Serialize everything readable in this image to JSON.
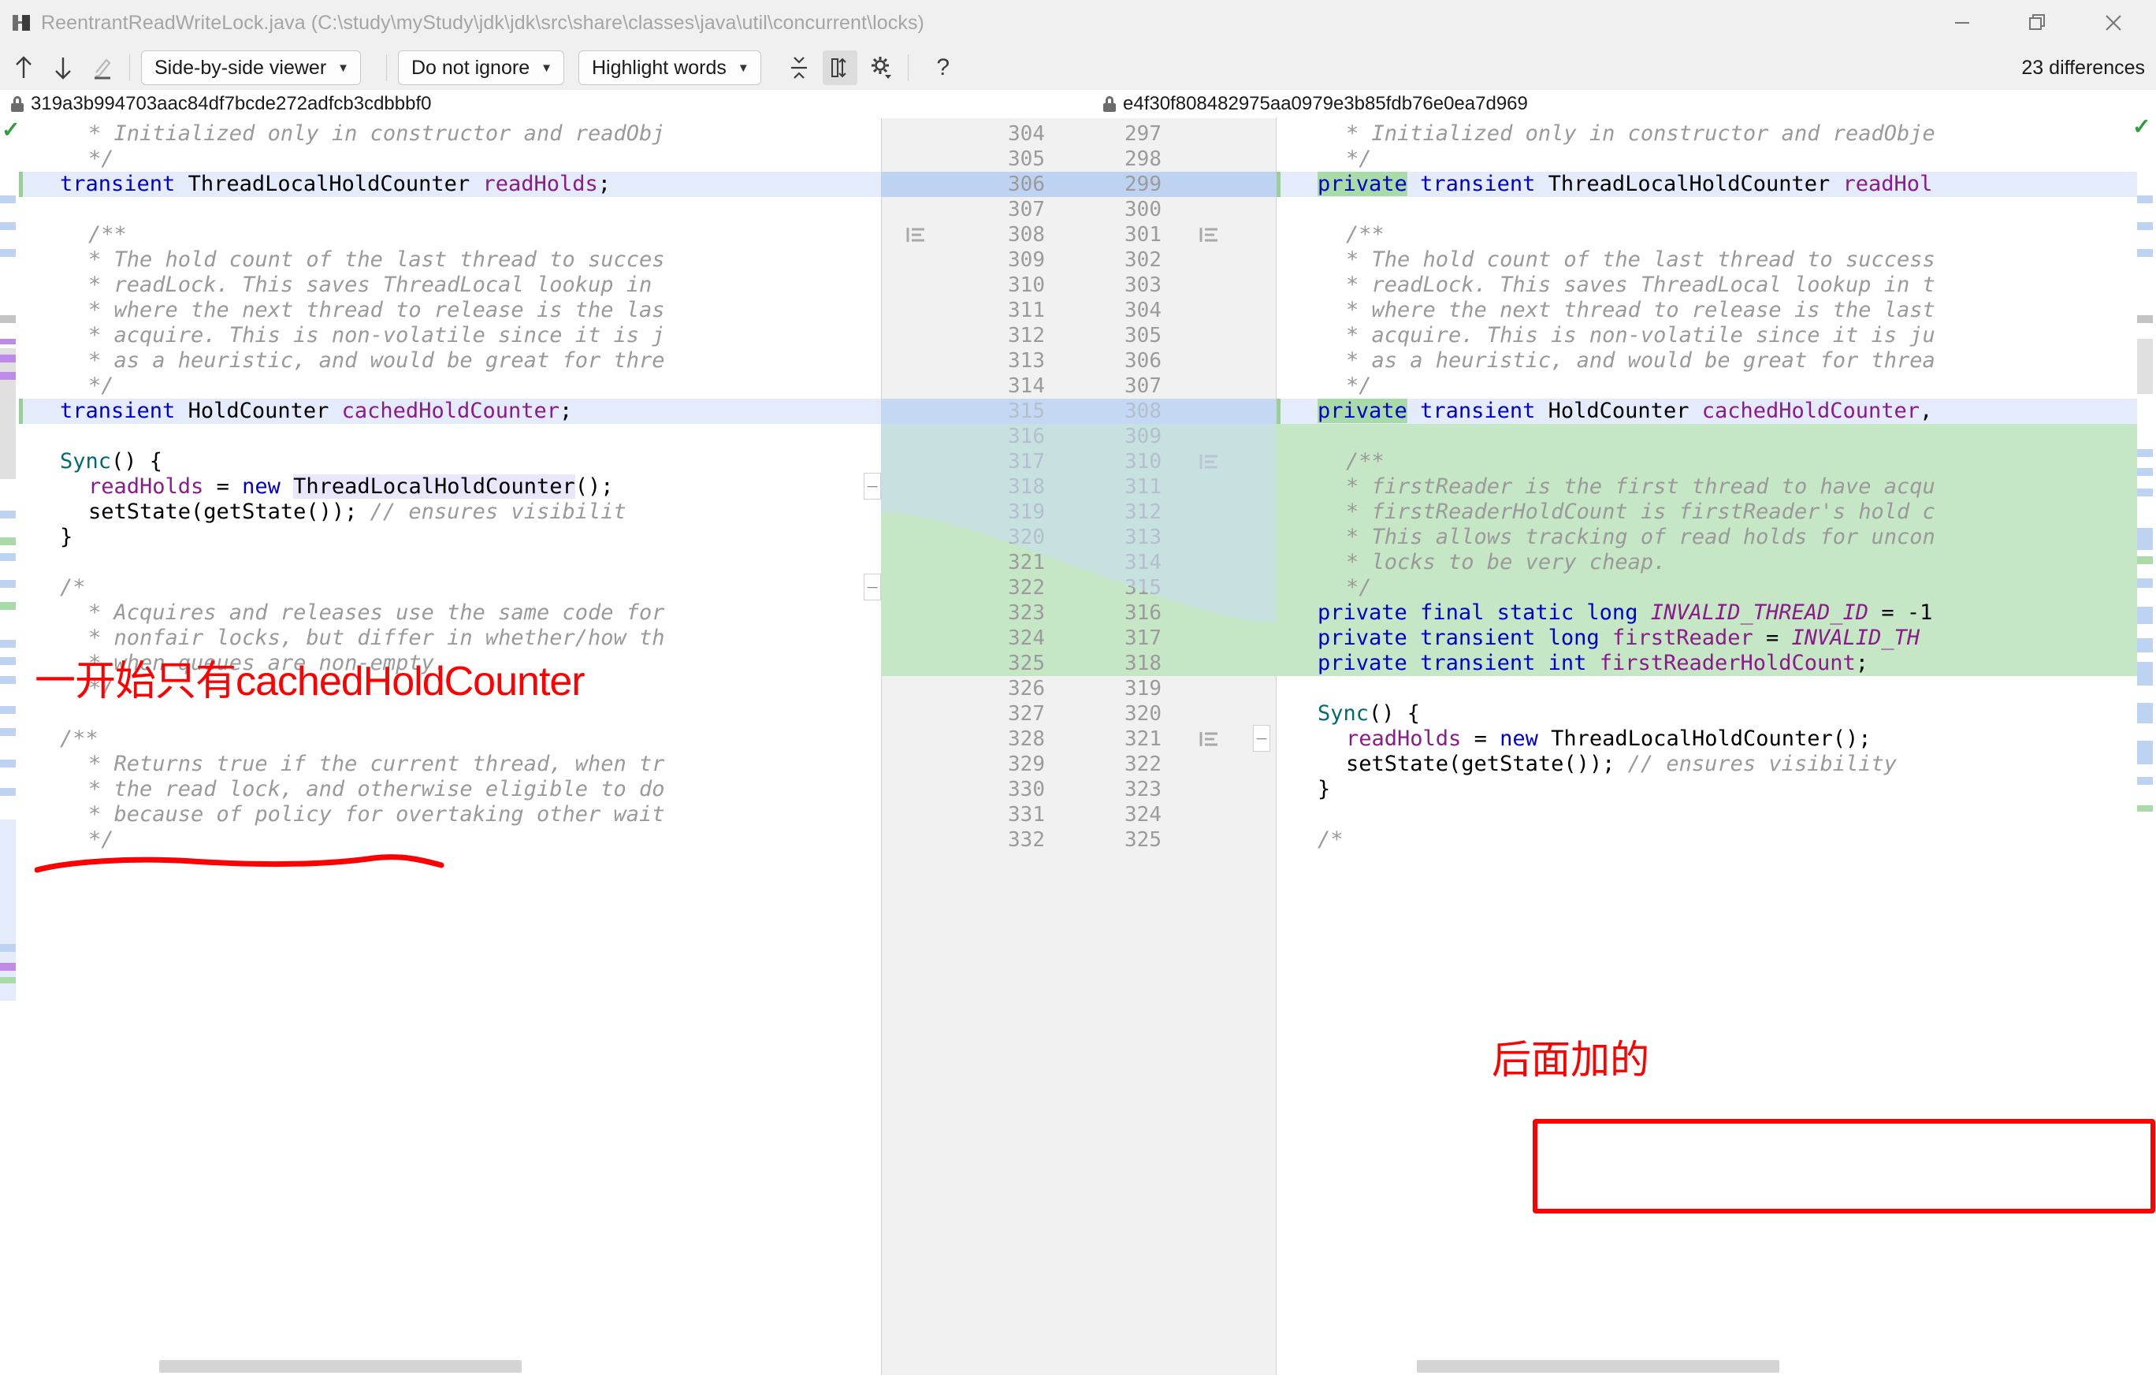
{
  "window": {
    "title": "ReentrantReadWriteLock.java (C:\\study\\myStudy\\jdk\\jdk\\src\\share\\classes\\java\\util\\concurrent\\locks)",
    "app_icon": "diff-icon",
    "minimize_label": "—",
    "maximize_label": "❐",
    "close_label": "✕"
  },
  "toolbar": {
    "prev_diff_icon": "arrow-up-icon",
    "next_diff_icon": "arrow-down-icon",
    "edit_icon": "pencil-icon",
    "viewer_mode": "Side-by-side viewer",
    "ignore_mode": "Do not ignore",
    "highlight_mode": "Highlight words",
    "caret": "▼",
    "collapse_icon": "collapse-unchanged-icon",
    "align_icon": "align-columns-icon",
    "settings_icon": "gear-icon",
    "help_icon": "help-icon",
    "differences_label": "23 differences"
  },
  "revisions": {
    "left_hash": "319a3b994703aac84df7bcde272adfcb3cdbbbf0",
    "right_hash": "e4f30f808482975aa0979e3b85fdb76e0ea7d969",
    "lock_icon": "lock-icon"
  },
  "annotations": [
    {
      "id": "note-before",
      "text": "一开始只有cachedHoldCounter",
      "color": "#ff0000"
    },
    {
      "id": "note-after",
      "text": "后面加的",
      "color": "#ff0000"
    }
  ],
  "left_pane": {
    "line_numbers": [
      304,
      305,
      306,
      307,
      308,
      309,
      310,
      311,
      312,
      313,
      314,
      315,
      316,
      317,
      318,
      319,
      320,
      321,
      322,
      323,
      324,
      325,
      326,
      327,
      328,
      329,
      330,
      331,
      332
    ],
    "lines": [
      {
        "n": 304,
        "state": "same",
        "indent": 1,
        "tokens": [
          {
            "t": "* Initialized only in constructor and readObj",
            "c": "c"
          }
        ]
      },
      {
        "n": 305,
        "state": "same",
        "indent": 1,
        "tokens": [
          {
            "t": "*/",
            "c": "c"
          }
        ]
      },
      {
        "n": 306,
        "state": "changed",
        "indent": 0,
        "tokens": [
          {
            "t": "transient",
            "c": "k"
          },
          {
            "t": " ",
            "c": "t"
          },
          {
            "t": "ThreadLocalHoldCounter",
            "c": "t"
          },
          {
            "t": " ",
            "c": "t"
          },
          {
            "t": "readHolds",
            "c": "f"
          },
          {
            "t": ";",
            "c": "t"
          }
        ]
      },
      {
        "n": 307,
        "state": "same",
        "indent": 0,
        "tokens": []
      },
      {
        "n": 308,
        "state": "same",
        "indent": 1,
        "tokens": [
          {
            "t": "/**",
            "c": "c"
          }
        ]
      },
      {
        "n": 309,
        "state": "same",
        "indent": 1,
        "tokens": [
          {
            "t": "* The hold count of the last thread to succes",
            "c": "c"
          }
        ]
      },
      {
        "n": 310,
        "state": "same",
        "indent": 1,
        "tokens": [
          {
            "t": "* readLock. This saves ThreadLocal lookup in",
            "c": "c"
          }
        ]
      },
      {
        "n": 311,
        "state": "same",
        "indent": 1,
        "tokens": [
          {
            "t": "* where the next thread to release is the las",
            "c": "c"
          }
        ]
      },
      {
        "n": 312,
        "state": "same",
        "indent": 1,
        "tokens": [
          {
            "t": "* acquire. This is non-volatile since it is j",
            "c": "c"
          }
        ]
      },
      {
        "n": 313,
        "state": "same",
        "indent": 1,
        "tokens": [
          {
            "t": "* as a heuristic, and would be great for thre",
            "c": "c"
          }
        ]
      },
      {
        "n": 314,
        "state": "same",
        "indent": 1,
        "tokens": [
          {
            "t": "*/",
            "c": "c"
          }
        ]
      },
      {
        "n": 315,
        "state": "changed",
        "indent": 0,
        "tokens": [
          {
            "t": "transient",
            "c": "k"
          },
          {
            "t": " ",
            "c": "t"
          },
          {
            "t": "HoldCounter",
            "c": "t"
          },
          {
            "t": " ",
            "c": "t"
          },
          {
            "t": "cachedHoldCounter",
            "c": "f"
          },
          {
            "t": ";",
            "c": "t"
          }
        ]
      },
      {
        "n": 316,
        "state": "same",
        "indent": 0,
        "tokens": []
      },
      {
        "n": 317,
        "state": "same",
        "indent": 0,
        "tokens": [
          {
            "t": "Sync",
            "c": "m"
          },
          {
            "t": "() {",
            "c": "t"
          }
        ]
      },
      {
        "n": 318,
        "state": "same",
        "indent": 1,
        "tokens": [
          {
            "t": "readHolds",
            "c": "f"
          },
          {
            "t": " = ",
            "c": "t"
          },
          {
            "t": "new",
            "c": "k"
          },
          {
            "t": " ",
            "c": "t"
          },
          {
            "t": "ThreadLocalHoldCounter",
            "c": "t",
            "hl": "lav"
          },
          {
            "t": "();",
            "c": "t"
          }
        ]
      },
      {
        "n": 319,
        "state": "same",
        "indent": 1,
        "tokens": [
          {
            "t": "setState(getState()); ",
            "c": "t"
          },
          {
            "t": "// ensures visibilit",
            "c": "c"
          }
        ]
      },
      {
        "n": 320,
        "state": "same",
        "indent": 0,
        "tokens": [
          {
            "t": "}",
            "c": "t"
          }
        ]
      },
      {
        "n": 321,
        "state": "same",
        "indent": 0,
        "tokens": []
      },
      {
        "n": 322,
        "state": "same",
        "indent": 0,
        "tokens": [
          {
            "t": "/*",
            "c": "c"
          }
        ]
      },
      {
        "n": 323,
        "state": "same",
        "indent": 1,
        "tokens": [
          {
            "t": "* Acquires and releases use the same code for",
            "c": "c"
          }
        ]
      },
      {
        "n": 324,
        "state": "same",
        "indent": 1,
        "tokens": [
          {
            "t": "* nonfair locks, but differ in whether/how th",
            "c": "c"
          }
        ]
      },
      {
        "n": 325,
        "state": "same",
        "indent": 1,
        "tokens": [
          {
            "t": "* when queues are non-empty.",
            "c": "c"
          }
        ]
      },
      {
        "n": 326,
        "state": "same",
        "indent": 1,
        "tokens": [
          {
            "t": "*/",
            "c": "c"
          }
        ]
      },
      {
        "n": 327,
        "state": "same",
        "indent": 0,
        "tokens": []
      },
      {
        "n": 328,
        "state": "same",
        "indent": 0,
        "tokens": [
          {
            "t": "/**",
            "c": "c"
          }
        ]
      },
      {
        "n": 329,
        "state": "same",
        "indent": 1,
        "tokens": [
          {
            "t": "* Returns true if the current thread, when tr",
            "c": "c"
          }
        ]
      },
      {
        "n": 330,
        "state": "same",
        "indent": 1,
        "tokens": [
          {
            "t": "* the read lock, and otherwise eligible to do",
            "c": "c"
          }
        ]
      },
      {
        "n": 331,
        "state": "same",
        "indent": 1,
        "tokens": [
          {
            "t": "* because of policy for overtaking other wait",
            "c": "c"
          }
        ]
      },
      {
        "n": 332,
        "state": "same",
        "indent": 1,
        "tokens": [
          {
            "t": "*/",
            "c": "c"
          }
        ]
      }
    ]
  },
  "right_pane": {
    "line_numbers": [
      297,
      298,
      299,
      300,
      301,
      302,
      303,
      304,
      305,
      306,
      307,
      308,
      309,
      310,
      311,
      312,
      313,
      314,
      315,
      316,
      317,
      318,
      319,
      320,
      321,
      322,
      323,
      324,
      325
    ],
    "lines": [
      {
        "n": 297,
        "state": "same",
        "indent": 1,
        "tokens": [
          {
            "t": "* Initialized only in constructor and readObje",
            "c": "c"
          }
        ]
      },
      {
        "n": 298,
        "state": "same",
        "indent": 1,
        "tokens": [
          {
            "t": "*/",
            "c": "c"
          }
        ]
      },
      {
        "n": 299,
        "state": "changed",
        "indent": 0,
        "tokens": [
          {
            "t": "private",
            "c": "k",
            "hl": "green"
          },
          {
            "t": " ",
            "c": "t"
          },
          {
            "t": "transient",
            "c": "k"
          },
          {
            "t": " ",
            "c": "t"
          },
          {
            "t": "ThreadLocalHoldCounter",
            "c": "t"
          },
          {
            "t": " ",
            "c": "t"
          },
          {
            "t": "readHol",
            "c": "f"
          }
        ]
      },
      {
        "n": 300,
        "state": "same",
        "indent": 0,
        "tokens": []
      },
      {
        "n": 301,
        "state": "same",
        "indent": 1,
        "tokens": [
          {
            "t": "/**",
            "c": "c"
          }
        ]
      },
      {
        "n": 302,
        "state": "same",
        "indent": 1,
        "tokens": [
          {
            "t": "* The hold count of the last thread to success",
            "c": "c"
          }
        ]
      },
      {
        "n": 303,
        "state": "same",
        "indent": 1,
        "tokens": [
          {
            "t": "* readLock. This saves ThreadLocal lookup in t",
            "c": "c"
          }
        ]
      },
      {
        "n": 304,
        "state": "same",
        "indent": 1,
        "tokens": [
          {
            "t": "* where the next thread to release is the last",
            "c": "c"
          }
        ]
      },
      {
        "n": 305,
        "state": "same",
        "indent": 1,
        "tokens": [
          {
            "t": "* acquire. This is non-volatile since it is ju",
            "c": "c"
          }
        ]
      },
      {
        "n": 306,
        "state": "same",
        "indent": 1,
        "tokens": [
          {
            "t": "* as a heuristic, and would be great for threa",
            "c": "c"
          }
        ]
      },
      {
        "n": 307,
        "state": "same",
        "indent": 1,
        "tokens": [
          {
            "t": "*/",
            "c": "c"
          }
        ]
      },
      {
        "n": 308,
        "state": "changed",
        "indent": 0,
        "tokens": [
          {
            "t": "private",
            "c": "k",
            "hl": "green"
          },
          {
            "t": " ",
            "c": "t"
          },
          {
            "t": "transient",
            "c": "k"
          },
          {
            "t": " ",
            "c": "t"
          },
          {
            "t": "HoldCounter",
            "c": "t"
          },
          {
            "t": " ",
            "c": "t"
          },
          {
            "t": "cachedHoldCounter",
            "c": "f"
          },
          {
            "t": ",",
            "c": "t"
          }
        ]
      },
      {
        "n": 309,
        "state": "added",
        "indent": 0,
        "tokens": []
      },
      {
        "n": 310,
        "state": "added",
        "indent": 1,
        "tokens": [
          {
            "t": "/**",
            "c": "c"
          }
        ]
      },
      {
        "n": 311,
        "state": "added",
        "indent": 1,
        "tokens": [
          {
            "t": "* firstReader is the first thread to have acqu",
            "c": "c"
          }
        ]
      },
      {
        "n": 312,
        "state": "added",
        "indent": 1,
        "tokens": [
          {
            "t": "* firstReaderHoldCount is firstReader's hold c",
            "c": "c"
          }
        ]
      },
      {
        "n": 313,
        "state": "added",
        "indent": 1,
        "tokens": [
          {
            "t": "* This allows tracking of read holds for uncon",
            "c": "c"
          }
        ]
      },
      {
        "n": 314,
        "state": "added",
        "indent": 1,
        "tokens": [
          {
            "t": "* locks to be very cheap.",
            "c": "c"
          }
        ]
      },
      {
        "n": 315,
        "state": "added",
        "indent": 1,
        "tokens": [
          {
            "t": "*/",
            "c": "c"
          }
        ]
      },
      {
        "n": 316,
        "state": "added",
        "indent": 0,
        "tokens": [
          {
            "t": "private",
            "c": "k"
          },
          {
            "t": " ",
            "c": "t"
          },
          {
            "t": "final",
            "c": "k"
          },
          {
            "t": " ",
            "c": "t"
          },
          {
            "t": "static",
            "c": "k"
          },
          {
            "t": " ",
            "c": "t"
          },
          {
            "t": "long",
            "c": "k"
          },
          {
            "t": " ",
            "c": "t"
          },
          {
            "t": "INVALID_THREAD_ID",
            "c": "fi"
          },
          {
            "t": " = -1",
            "c": "t"
          }
        ]
      },
      {
        "n": 317,
        "state": "added",
        "indent": 0,
        "tokens": [
          {
            "t": "private",
            "c": "k"
          },
          {
            "t": " ",
            "c": "t"
          },
          {
            "t": "transient",
            "c": "k"
          },
          {
            "t": " ",
            "c": "t"
          },
          {
            "t": "long",
            "c": "k"
          },
          {
            "t": " ",
            "c": "t"
          },
          {
            "t": "firstReader",
            "c": "f"
          },
          {
            "t": " = ",
            "c": "t"
          },
          {
            "t": "INVALID_TH",
            "c": "fi"
          }
        ]
      },
      {
        "n": 318,
        "state": "added",
        "indent": 0,
        "tokens": [
          {
            "t": "private",
            "c": "k"
          },
          {
            "t": " ",
            "c": "t"
          },
          {
            "t": "transient",
            "c": "k"
          },
          {
            "t": " ",
            "c": "t"
          },
          {
            "t": "int",
            "c": "k"
          },
          {
            "t": " ",
            "c": "t"
          },
          {
            "t": "firstReaderHoldCount",
            "c": "f"
          },
          {
            "t": ";",
            "c": "t"
          }
        ]
      },
      {
        "n": 319,
        "state": "same",
        "indent": 0,
        "tokens": []
      },
      {
        "n": 320,
        "state": "same",
        "indent": 0,
        "tokens": [
          {
            "t": "Sync",
            "c": "m"
          },
          {
            "t": "() {",
            "c": "t"
          }
        ]
      },
      {
        "n": 321,
        "state": "same",
        "indent": 1,
        "tokens": [
          {
            "t": "readHolds",
            "c": "f"
          },
          {
            "t": " = ",
            "c": "t"
          },
          {
            "t": "new",
            "c": "k"
          },
          {
            "t": " ",
            "c": "t"
          },
          {
            "t": "ThreadLocalHoldCounter",
            "c": "t"
          },
          {
            "t": "();",
            "c": "t"
          }
        ]
      },
      {
        "n": 322,
        "state": "same",
        "indent": 1,
        "tokens": [
          {
            "t": "setState(getState()); ",
            "c": "t"
          },
          {
            "t": "// ensures visibility",
            "c": "c"
          }
        ]
      },
      {
        "n": 323,
        "state": "same",
        "indent": 0,
        "tokens": [
          {
            "t": "}",
            "c": "t"
          }
        ]
      },
      {
        "n": 324,
        "state": "same",
        "indent": 0,
        "tokens": []
      },
      {
        "n": 325,
        "state": "same",
        "indent": 0,
        "tokens": [
          {
            "t": "/*",
            "c": "c"
          }
        ]
      }
    ]
  },
  "colors": {
    "changed_line_bg": "#e4ecfb",
    "added_line_bg": "#c6e7c6",
    "gutter_changed_bg": "#bed3f2",
    "gutter_added_bg": "#c6e7c6",
    "annotation_red": "#ff0000",
    "keyword": "#0000cd",
    "field": "#8b1a8b",
    "comment": "#9a9a9a",
    "method": "#006b75"
  }
}
